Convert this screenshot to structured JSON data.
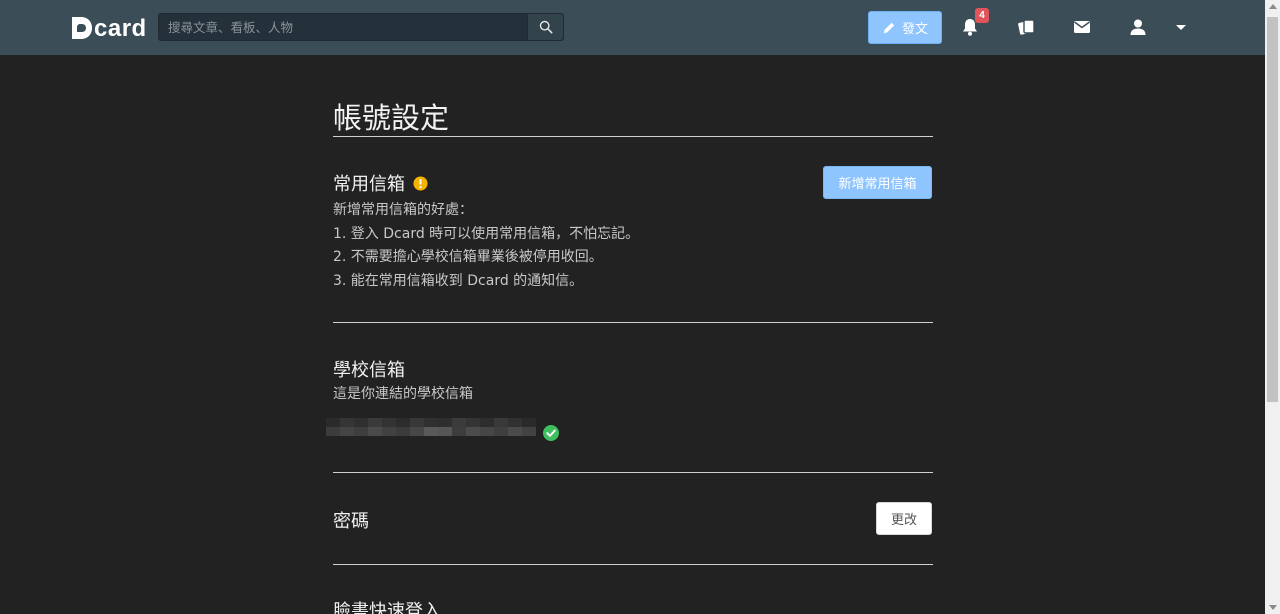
{
  "header": {
    "logo_text": "card",
    "search": {
      "placeholder": "搜尋文章、看板、人物"
    },
    "post_label": "發文",
    "notification_count": "4"
  },
  "page": {
    "title": "帳號設定"
  },
  "sections": {
    "common_email": {
      "title": "常用信箱",
      "add_button": "新增常用信箱",
      "benefits_heading": "新增常用信箱的好處：",
      "benefits": [
        "1. 登入 Dcard 時可以使用常用信箱，不怕忘記。",
        "2. 不需要擔心學校信箱畢業後被停用收回。",
        "3. 能在常用信箱收到 Dcard 的通知信。"
      ]
    },
    "school_email": {
      "title": "學校信箱",
      "description": "這是你連結的學校信箱"
    },
    "password": {
      "title": "密碼",
      "change_button": "更改"
    },
    "facebook": {
      "title": "臉書快速登入"
    }
  },
  "colors": {
    "topbar": "#3b4d57",
    "background": "#222222",
    "accent": "#8ec5ff",
    "badge": "#e0555b",
    "warning": "#f5b400",
    "verified": "#3fbf5f"
  }
}
